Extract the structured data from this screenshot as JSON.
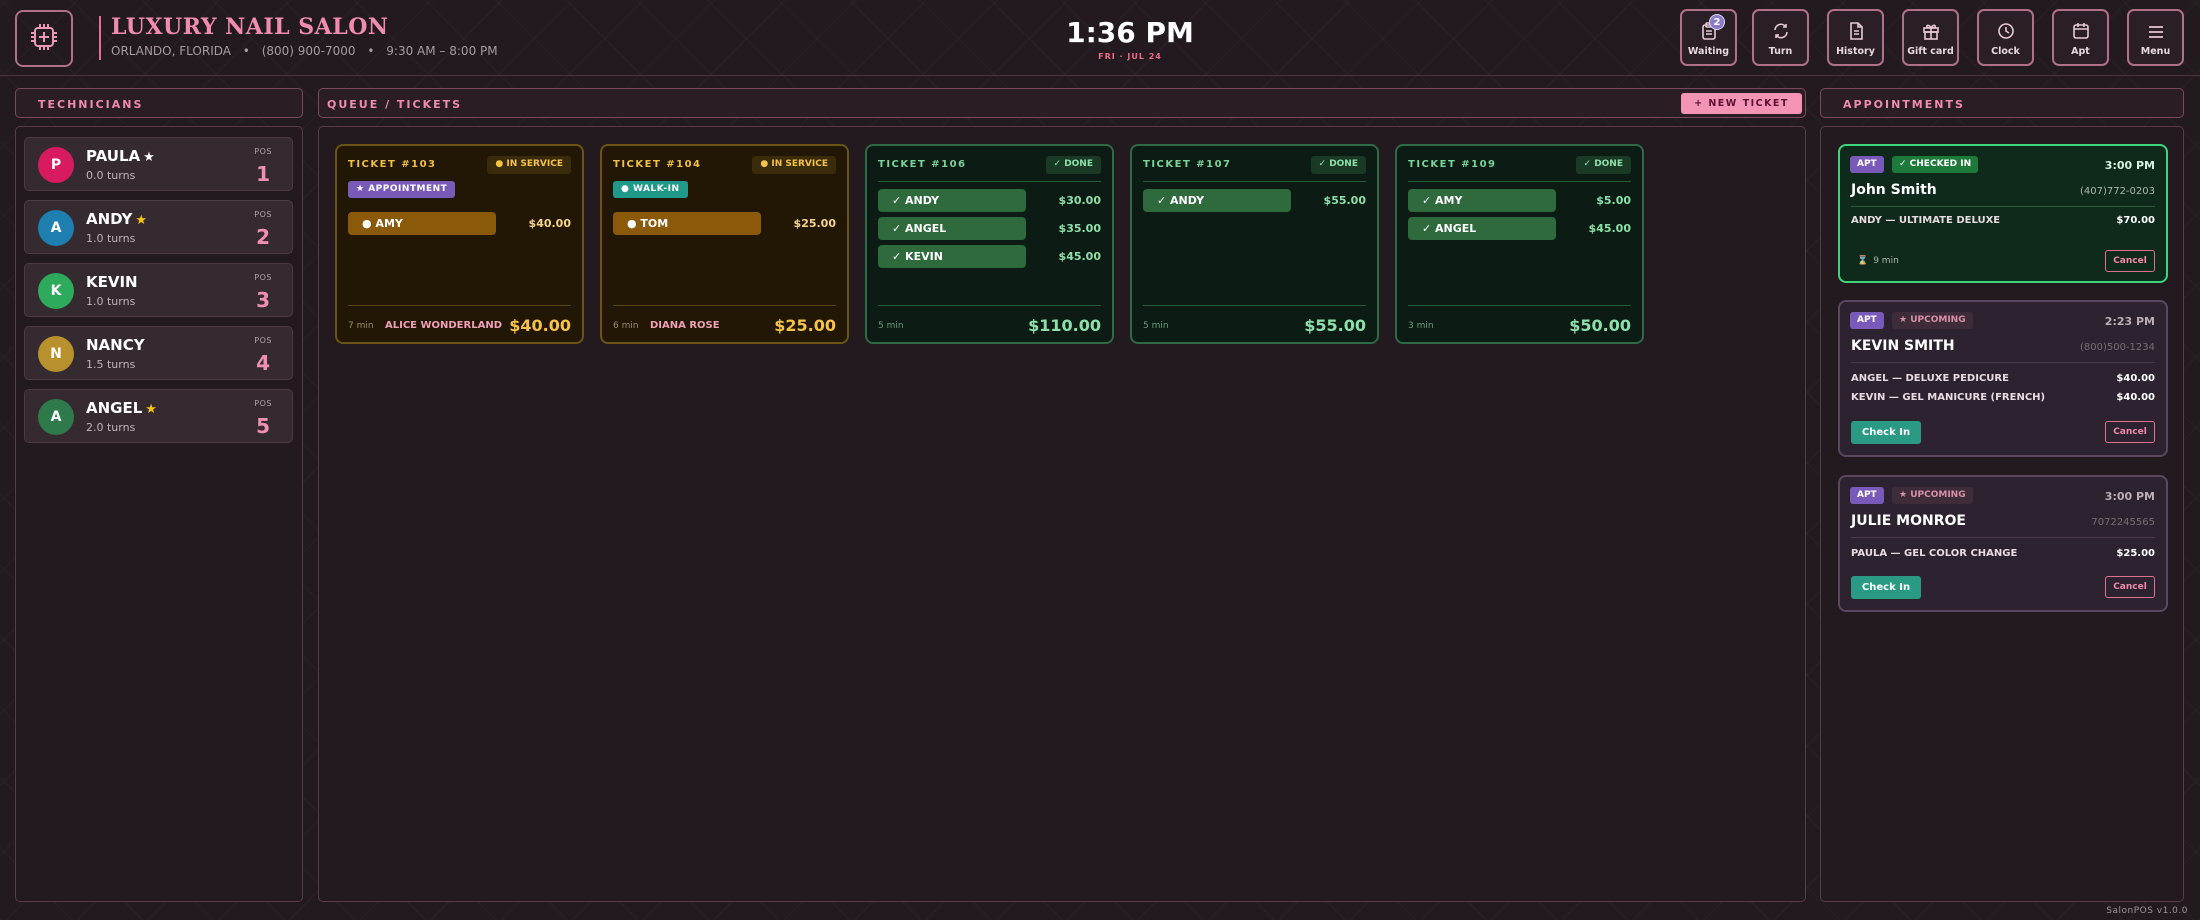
{
  "header": {
    "title": "LUXURY NAIL SALON",
    "location": "ORLANDO, FLORIDA",
    "phone": "(800) 900-7000",
    "hours": "9:30 AM – 8:00 PM",
    "separator": "•",
    "time": "1:36 PM",
    "date": "FRI · JUL 24",
    "logo_icon": "chip-icon"
  },
  "toolbar": [
    {
      "label": "Waiting",
      "icon": "clipboard-icon",
      "badge": "2"
    },
    {
      "label": "Turn",
      "icon": "refresh-icon"
    },
    {
      "label": "History",
      "icon": "document-icon"
    },
    {
      "label": "Gift card",
      "icon": "gift-icon"
    },
    {
      "label": "Clock",
      "icon": "clock-icon"
    },
    {
      "label": "Apt",
      "icon": "calendar-icon"
    },
    {
      "label": "Menu",
      "icon": "hamburger-icon"
    }
  ],
  "technicians": {
    "heading": "TECHNICIANS",
    "pos_label": "POS",
    "items": [
      {
        "initial": "P",
        "name": "PAULA",
        "star": "★",
        "star_color": "#ffffff",
        "turns": "0.0 turns",
        "pos": "1",
        "color": "#d81b60"
      },
      {
        "initial": "A",
        "name": "ANDY",
        "star": "★",
        "star_color": "#f5c518",
        "turns": "1.0 turns",
        "pos": "2",
        "color": "#1e7fb0"
      },
      {
        "initial": "K",
        "name": "KEVIN",
        "star": "",
        "star_color": "#ffffff",
        "turns": "1.0 turns",
        "pos": "3",
        "color": "#2eaa5c"
      },
      {
        "initial": "N",
        "name": "NANCY",
        "star": "",
        "star_color": "#ffffff",
        "turns": "1.5 turns",
        "pos": "4",
        "color": "#b8902e"
      },
      {
        "initial": "A",
        "name": "ANGEL",
        "star": "★",
        "star_color": "#f5c518",
        "turns": "2.0 turns",
        "pos": "5",
        "color": "#2e7a4a"
      }
    ]
  },
  "queue": {
    "heading": "QUEUE  /  TICKETS",
    "new_ticket": "+  NEW TICKET",
    "tickets": [
      {
        "number": "TICKET  #103",
        "status": "● IN SERVICE",
        "state": "ins",
        "type": "★  APPOINTMENT",
        "type_color": "#7a5ab8",
        "services": [
          {
            "tech": "● AMY",
            "price": "$40.00"
          }
        ],
        "minutes": "7 min",
        "customer": "ALICE WONDERLAND",
        "total": "$40.00"
      },
      {
        "number": "TICKET  #104",
        "status": "● IN SERVICE",
        "state": "ins",
        "type": "●  WALK-IN",
        "type_color": "#1f9a8a",
        "services": [
          {
            "tech": "● TOM",
            "price": "$25.00"
          }
        ],
        "minutes": "6 min",
        "customer": "DIANA ROSE",
        "total": "$25.00"
      },
      {
        "number": "TICKET  #106",
        "status": "✓  DONE",
        "state": "done",
        "type": "",
        "type_color": "",
        "services": [
          {
            "tech": "✓  ANDY",
            "price": "$30.00"
          },
          {
            "tech": "✓  ANGEL",
            "price": "$35.00"
          },
          {
            "tech": "✓  KEVIN",
            "price": "$45.00"
          }
        ],
        "minutes": "5 min",
        "customer": "",
        "total": "$110.00"
      },
      {
        "number": "TICKET  #107",
        "status": "✓  DONE",
        "state": "done",
        "type": "",
        "type_color": "",
        "services": [
          {
            "tech": "✓  ANDY",
            "price": "$55.00"
          }
        ],
        "minutes": "5 min",
        "customer": "",
        "total": "$55.00"
      },
      {
        "number": "TICKET  #109",
        "status": "✓  DONE",
        "state": "done",
        "type": "",
        "type_color": "",
        "services": [
          {
            "tech": "✓  AMY",
            "price": "$5.00"
          },
          {
            "tech": "✓  ANGEL",
            "price": "$45.00"
          }
        ],
        "minutes": "3 min",
        "customer": "",
        "total": "$50.00"
      }
    ]
  },
  "appointments": {
    "heading": "APPOINTMENTS",
    "items": [
      {
        "tag": "APT",
        "status": "✓  CHECKED IN",
        "state": "checked",
        "time": "3:00 PM",
        "name": "John Smith",
        "phone": "(407)772-0203",
        "services": [
          {
            "label": "ANDY  —  ULTIMATE DELUXE",
            "price": "$70.00"
          }
        ],
        "waited": "9 min",
        "check_in": "",
        "cancel": "Cancel"
      },
      {
        "tag": "APT",
        "status": "★  UPCOMING",
        "state": "upcoming",
        "time": "2:23 PM",
        "name": "KEVIN SMITH",
        "phone": "(800)500-1234",
        "services": [
          {
            "label": "ANGEL  —  DELUXE PEDICURE",
            "price": "$40.00"
          },
          {
            "label": "KEVIN  —  GEL MANICURE (FRENCH)",
            "price": "$40.00"
          }
        ],
        "waited": "",
        "check_in": "Check In",
        "cancel": "Cancel"
      },
      {
        "tag": "APT",
        "status": "★  UPCOMING",
        "state": "upcoming",
        "time": "3:00 PM",
        "name": "JULIE MONROE",
        "phone": "7072245565",
        "services": [
          {
            "label": "PAULA  —  GEL COLOR CHANGE",
            "price": "$25.00"
          }
        ],
        "waited": "",
        "check_in": "Check In",
        "cancel": "Cancel"
      }
    ]
  },
  "version": "SalonPOS v1.0.0",
  "colors": {
    "accent": "#f08cb0",
    "in_service": "#f5c24a",
    "done": "#8ee0aa",
    "checkin": "#2a9a84"
  }
}
